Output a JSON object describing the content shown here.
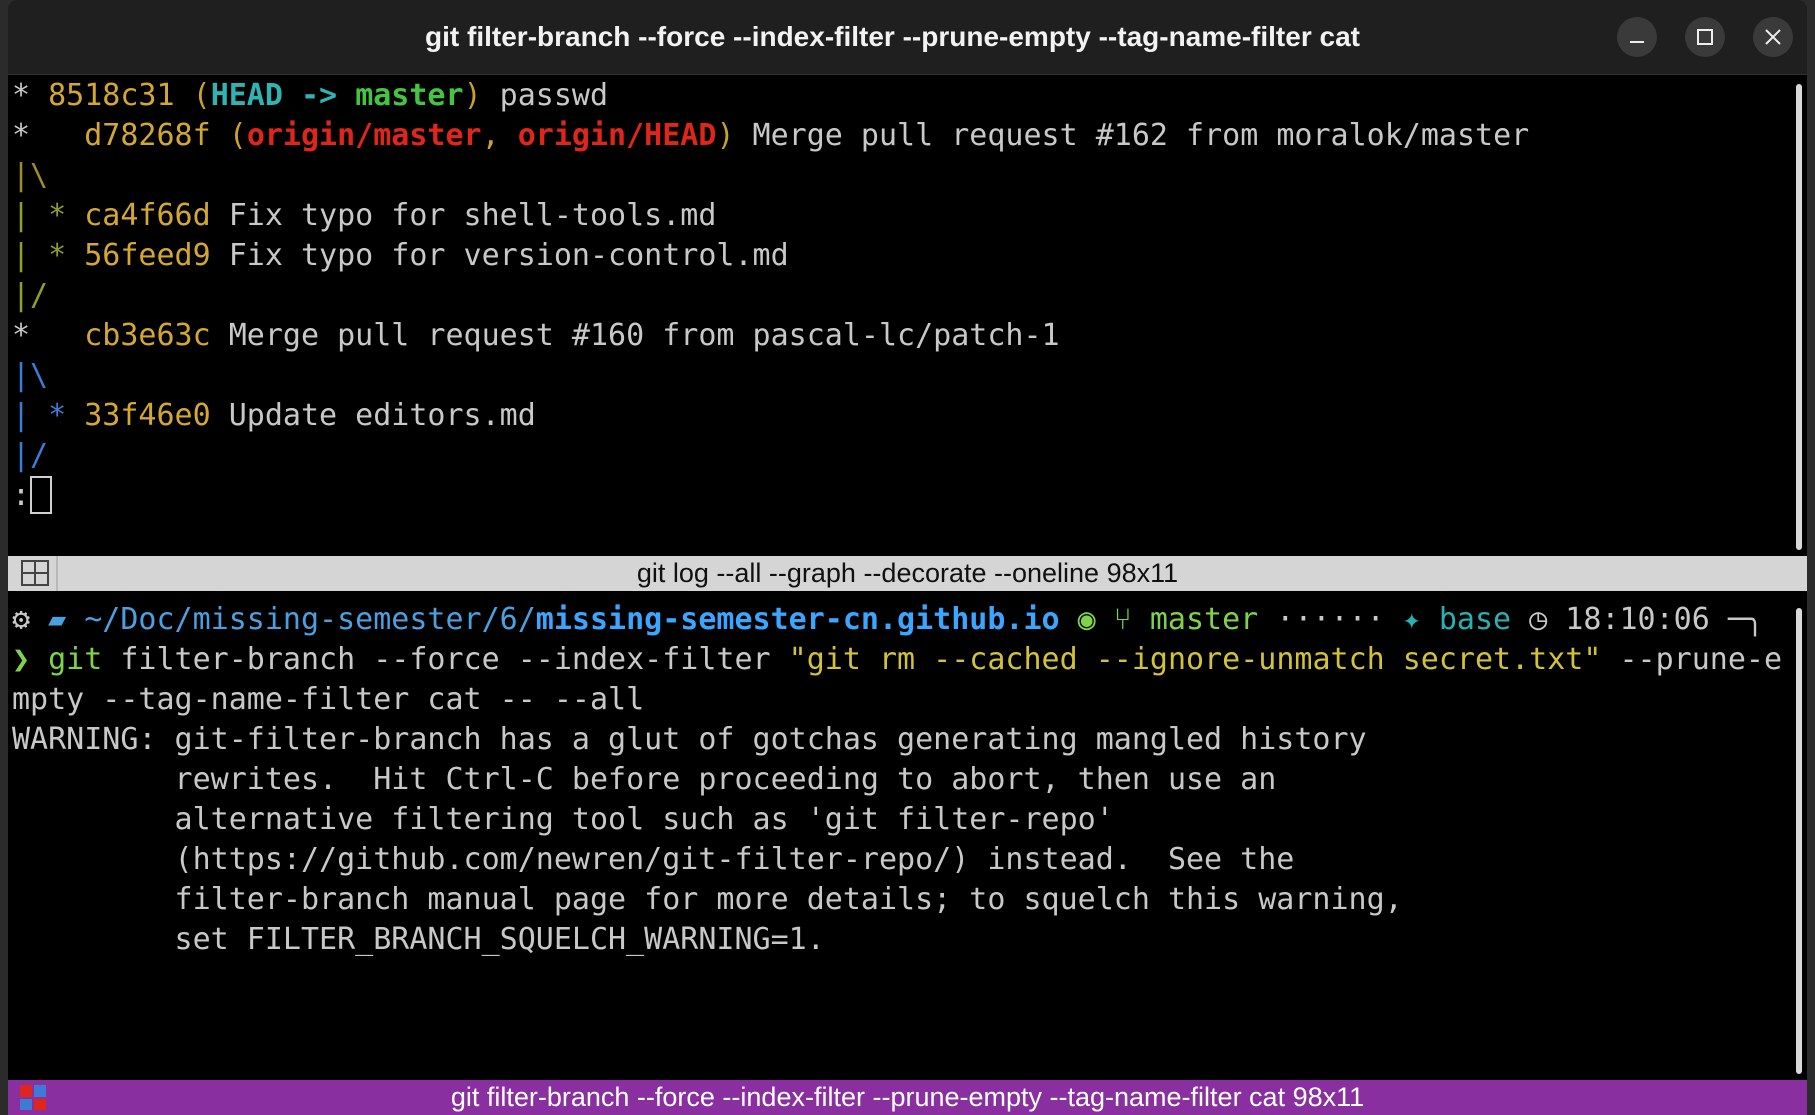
{
  "window": {
    "title": "git filter-branch --force --index-filter  --prune-empty --tag-name-filter cat"
  },
  "top_pane": {
    "lines": [
      {
        "graph": "* ",
        "hash": "8518c31",
        "refs_open": " (",
        "head": "HEAD -> ",
        "branch": "master",
        "refs_close": ")",
        "msg": " passwd"
      },
      {
        "graph": "*   ",
        "hash": "d78268f",
        "refs_open": " (",
        "ref1": "origin/master",
        "comma": ", ",
        "ref2": "origin/HEAD",
        "refs_close": ")",
        "msg": " Merge pull request #162 from moralok/master"
      },
      {
        "graph": "|\\"
      },
      {
        "graph": "| * ",
        "hash": "ca4f66d",
        "msg": " Fix typo for shell-tools.md"
      },
      {
        "graph": "| * ",
        "hash": "56feed9",
        "msg": " Fix typo for version-control.md"
      },
      {
        "graph": "|/"
      },
      {
        "graph": "*   ",
        "hash": "cb3e63c",
        "msg": " Merge pull request #160 from pascal-lc/patch-1"
      },
      {
        "graph": "|\\"
      },
      {
        "graph": "| * ",
        "hash": "33f46e0",
        "msg": " Update editors.md"
      },
      {
        "graph": "|/"
      },
      {
        "prompt": ":"
      }
    ],
    "status": "git log --all --graph --decorate --oneline 98x11"
  },
  "bottom_pane": {
    "prompt_line": {
      "path_prefix": "~/Doc/missing-semester/6/",
      "path_repo": "missing-semester-cn.github.io",
      "branch": "master",
      "dots": "······",
      "env": "base",
      "time": "18:10:06",
      "corner": "─╮"
    },
    "command_prefix": "❯",
    "command_git": " git",
    "command_a": " filter-branch --force --index-filter ",
    "command_str": "\"git rm --cached --ignore-unmatch secret.txt\"",
    "command_b": " --prune-e",
    "command_wrap": "mpty --tag-name-filter cat -- --all",
    "output": [
      "WARNING: git-filter-branch has a glut of gotchas generating mangled history",
      "         rewrites.  Hit Ctrl-C before proceeding to abort, then use an",
      "         alternative filtering tool such as 'git filter-repo'",
      "         (https://github.com/newren/git-filter-repo/) instead.  See the",
      "         filter-branch manual page for more details; to squelch this warning,",
      "         set FILTER_BRANCH_SQUELCH_WARNING=1."
    ],
    "status": "git filter-branch --force --index-filter  --prune-empty --tag-name-filter cat 98x11"
  },
  "colors": {
    "status_active": "#8a2fa0",
    "status_inactive": "#d5d5d5"
  }
}
